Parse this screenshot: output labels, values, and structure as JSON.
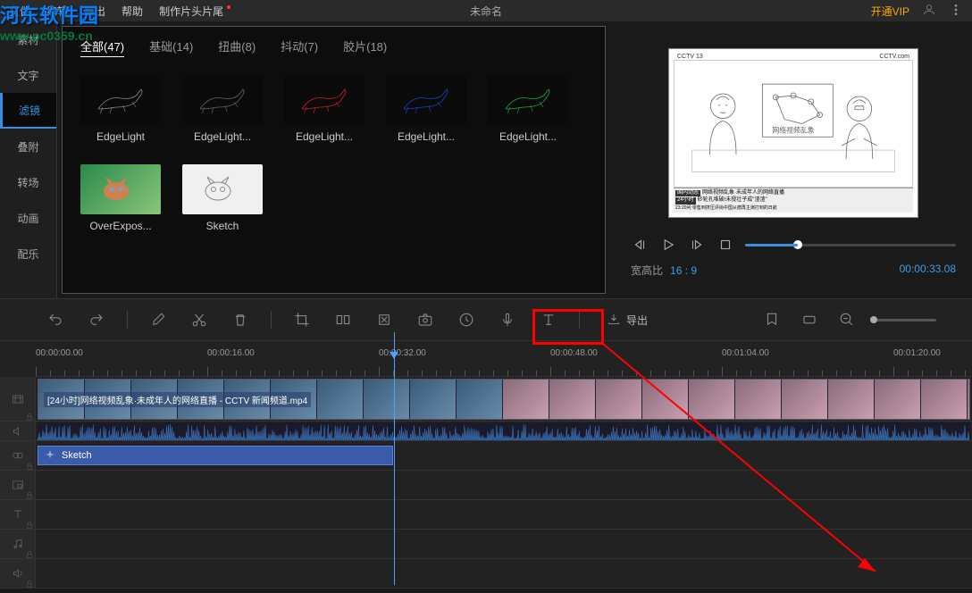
{
  "menu": {
    "file": "文件",
    "edit": "编辑",
    "export": "导出",
    "help": "帮助",
    "make_titles": "制作片头片尾",
    "title": "未命名",
    "vip": "开通VIP"
  },
  "watermark": {
    "line1": "河东软件园",
    "line2": "www.pc0359.cn"
  },
  "sidebar": {
    "items": [
      "素材",
      "文字",
      "滤镜",
      "叠附",
      "转场",
      "动画",
      "配乐"
    ]
  },
  "tabs": [
    {
      "label": "全部",
      "count": "(47)"
    },
    {
      "label": "基础",
      "count": "(14)"
    },
    {
      "label": "扭曲",
      "count": "(8)"
    },
    {
      "label": "抖动",
      "count": "(7)"
    },
    {
      "label": "胶片",
      "count": "(18)"
    }
  ],
  "effects": [
    {
      "name": "EdgeLight",
      "color": "#888"
    },
    {
      "name": "EdgeLight...",
      "color": "#666"
    },
    {
      "name": "EdgeLight...",
      "color": "#cc2030"
    },
    {
      "name": "EdgeLight...",
      "color": "#2040cc"
    },
    {
      "name": "EdgeLight...",
      "color": "#20aa40"
    },
    {
      "name": "OverExpos...",
      "color": "#40a060"
    },
    {
      "name": "Sketch",
      "color": "#aaa"
    }
  ],
  "preview": {
    "cctv_label": "CCTV 13",
    "cctv_com": "CCTV.com",
    "banner1": "网络视频乱象·未成年人的网络直播",
    "banner2": "砂轮孔堆破!未授壮子成\"渣渣\"",
    "banner3": "23:20问:零售到挤压评尚中国从德再主演打到的日航",
    "aspect_label": "宽高比",
    "aspect_value": "16 : 9",
    "time": "00:00:33.08"
  },
  "toolbar": {
    "export_label": "导出"
  },
  "timeline": {
    "marks": [
      "00:00:00.00",
      "00:00:16.00",
      "00:00:32.00",
      "00:00:48.00",
      "00:01:04.00",
      "00:01:20.00"
    ],
    "clip_title": "[24小时]网络视频乱象·未成年人的网络直播 - CCTV 新闻频道.mp4",
    "effect_clip": "Sketch"
  }
}
